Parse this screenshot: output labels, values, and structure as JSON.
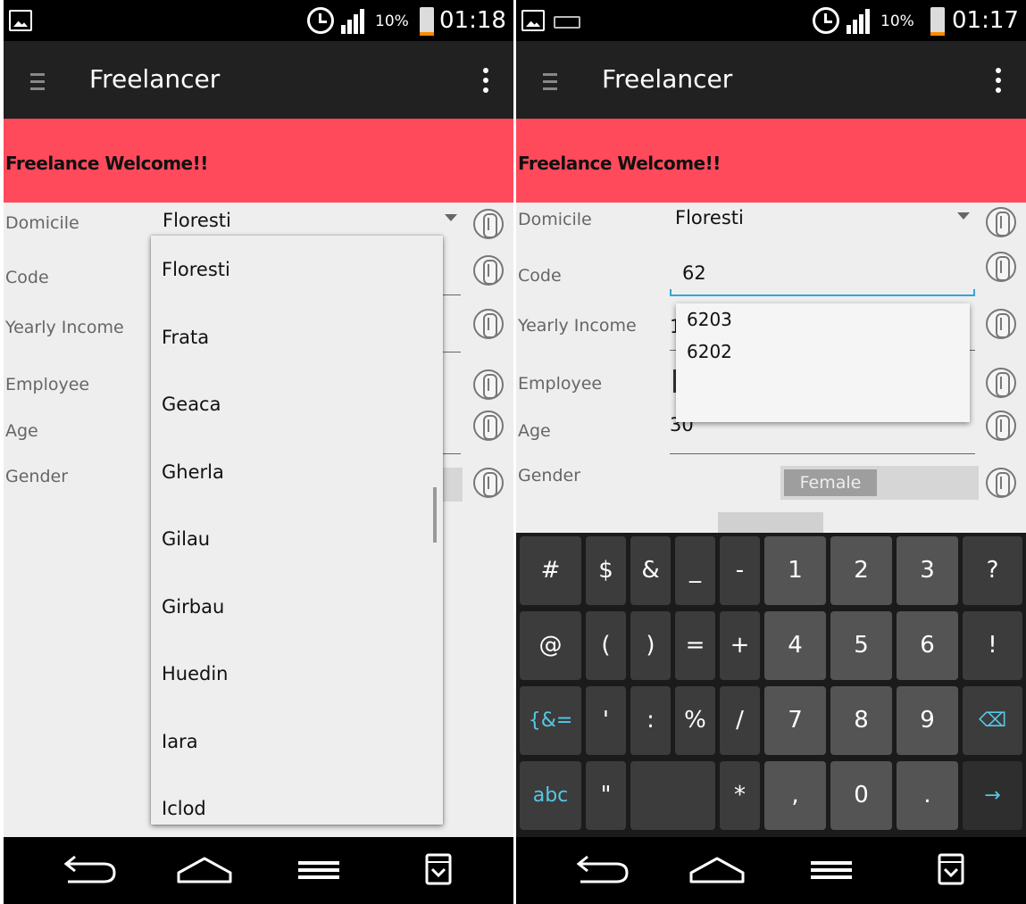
{
  "left": {
    "status": {
      "battery_pct": "10%",
      "time": "01:18"
    },
    "app_title": "Freelancer",
    "banner": "Freelance Welcome!!",
    "labels": {
      "domicile": "Domicile",
      "code": "Code",
      "yearly_income": "Yearly Income",
      "employee": "Employee",
      "age": "Age",
      "gender": "Gender"
    },
    "domicile_value": "Floresti",
    "dropdown_options": [
      "Floresti",
      "Frata",
      "Geaca",
      "Gherla",
      "Gilau",
      "Girbau",
      "Huedin",
      "Iara",
      "Iclod"
    ]
  },
  "right": {
    "status": {
      "battery_pct": "10%",
      "time": "01:17"
    },
    "app_title": "Freelancer",
    "banner": "Freelance Welcome!!",
    "labels": {
      "domicile": "Domicile",
      "code": "Code",
      "yearly_income": "Yearly Income",
      "employee": "Employee",
      "age": "Age",
      "gender": "Gender"
    },
    "domicile_value": "Floresti",
    "code_value": "62",
    "suggestions": [
      "6203",
      "6202"
    ],
    "yearly_income_partial": "1",
    "age_value": "30",
    "gender_selected": "Female",
    "keyboard": {
      "row1": [
        "#",
        "$",
        "&",
        "_",
        "-",
        "1",
        "2",
        "3",
        "?"
      ],
      "row2": [
        "@",
        "(",
        ")",
        "=",
        "+",
        "4",
        "5",
        "6",
        "!"
      ],
      "row3": [
        "{&=",
        "'",
        ":",
        "%",
        "/",
        "7",
        "8",
        "9",
        "⌫"
      ],
      "row4": [
        "abc",
        "\"",
        "",
        "*",
        ",",
        "0",
        ".",
        "→"
      ]
    }
  },
  "colors": {
    "banner": "#ff4a5c",
    "appbar": "#212121",
    "focus": "#33a6d9",
    "battery": "#ff8a00"
  },
  "icons": [
    "gallery-icon",
    "keyboard-icon",
    "alarm-icon",
    "signal-icon",
    "battery-icon",
    "menu-icon",
    "overflow-icon",
    "info-icon",
    "back-icon",
    "home-icon",
    "recents-icon",
    "download-icon"
  ]
}
